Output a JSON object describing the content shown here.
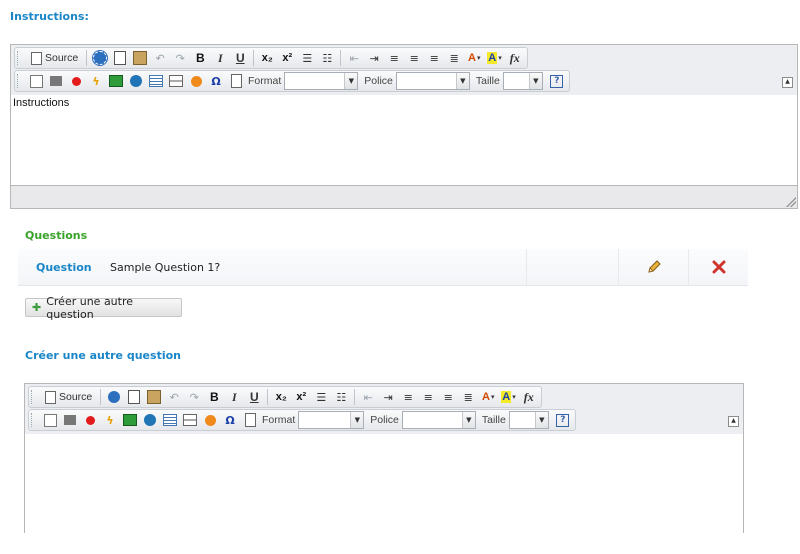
{
  "instructions_title": "Instructions:",
  "toolbar": {
    "source_label": "Source",
    "format_label": "Format",
    "font_label": "Police",
    "size_label": "Taille",
    "bold": "B",
    "italic": "I",
    "underline": "U",
    "subscript": "x₂",
    "superscript": "x²",
    "formula": "fx",
    "text_color": "A",
    "bg_color": "A",
    "omega": "Ω"
  },
  "editor1": {
    "content": "Instructions"
  },
  "questions_title": "Questions",
  "question_row": {
    "label": "Question",
    "text": "Sample Question 1?"
  },
  "create_button_label": "Créer une autre question",
  "create_title": "Créer une autre question",
  "editor2": {
    "content": ""
  }
}
